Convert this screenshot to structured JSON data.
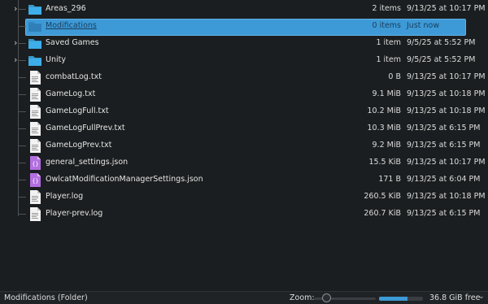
{
  "files": [
    {
      "name": "Areas_296",
      "kind": "folder",
      "size": "2 items",
      "modified": "9/13/25 at 10:17 PM",
      "expandable": true,
      "selected": false
    },
    {
      "name": "Modifications",
      "kind": "folder",
      "size": "0 items",
      "modified": "Just now",
      "expandable": false,
      "selected": true
    },
    {
      "name": "Saved Games",
      "kind": "folder",
      "size": "1 item",
      "modified": "9/5/25 at 5:52 PM",
      "expandable": true,
      "selected": false
    },
    {
      "name": "Unity",
      "kind": "folder",
      "size": "1 item",
      "modified": "9/5/25 at 5:52 PM",
      "expandable": true,
      "selected": false
    },
    {
      "name": "combatLog.txt",
      "kind": "text",
      "size": "0 B",
      "modified": "9/13/25 at 10:17 PM",
      "expandable": false,
      "selected": false
    },
    {
      "name": "GameLog.txt",
      "kind": "text",
      "size": "9.1 MiB",
      "modified": "9/13/25 at 10:18 PM",
      "expandable": false,
      "selected": false
    },
    {
      "name": "GameLogFull.txt",
      "kind": "text",
      "size": "10.2 MiB",
      "modified": "9/13/25 at 10:18 PM",
      "expandable": false,
      "selected": false
    },
    {
      "name": "GameLogFullPrev.txt",
      "kind": "text",
      "size": "10.3 MiB",
      "modified": "9/13/25 at 6:15 PM",
      "expandable": false,
      "selected": false
    },
    {
      "name": "GameLogPrev.txt",
      "kind": "text",
      "size": "9.2 MiB",
      "modified": "9/13/25 at 6:15 PM",
      "expandable": false,
      "selected": false
    },
    {
      "name": "general_settings.json",
      "kind": "json",
      "size": "15.5 KiB",
      "modified": "9/13/25 at 10:17 PM",
      "expandable": false,
      "selected": false
    },
    {
      "name": "OwlcatModificationManagerSettings.json",
      "kind": "json",
      "size": "171 B",
      "modified": "9/13/25 at 6:04 PM",
      "expandable": false,
      "selected": false
    },
    {
      "name": "Player.log",
      "kind": "text",
      "size": "260.5 KiB",
      "modified": "9/13/25 at 10:18 PM",
      "expandable": false,
      "selected": false
    },
    {
      "name": "Player-prev.log",
      "kind": "text",
      "size": "260.7 KiB",
      "modified": "9/13/25 at 6:15 PM",
      "expandable": false,
      "selected": false
    }
  ],
  "status": {
    "selection_text": "Modifications (Folder)",
    "zoom_label": "Zoom:",
    "zoom_level": 0.15,
    "disk_used_fraction": 0.65,
    "free_space": "36.8 GiB free"
  },
  "icons": {
    "expander": "chevron-right-icon",
    "folder": "folder-icon",
    "text": "text-file-icon",
    "json": "json-file-icon"
  },
  "colors": {
    "selection": "#3d9ad6",
    "folder": "#3daee9",
    "json": "#b36fe0"
  }
}
